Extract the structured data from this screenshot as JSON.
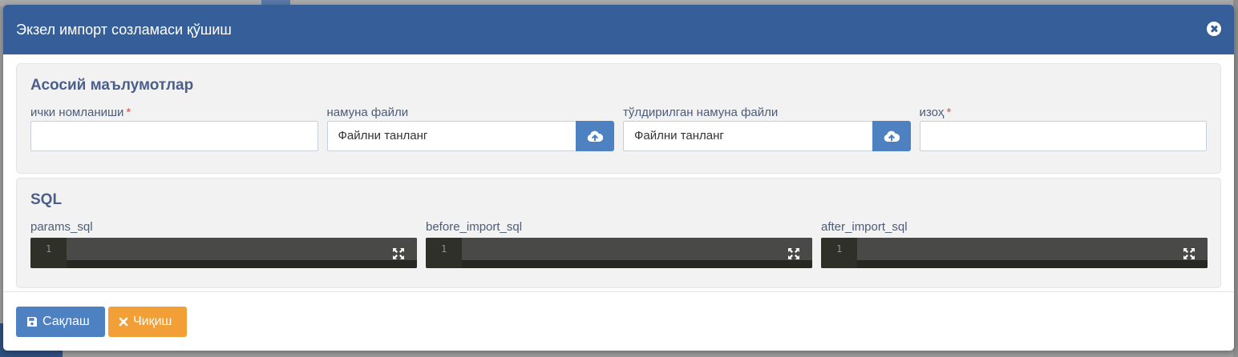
{
  "modal": {
    "title": "Экзел импорт созламаси қўшиш"
  },
  "basic": {
    "title": "Асосий маълумотлар",
    "fields": {
      "internal_name": {
        "label": "ички номланиши",
        "required_mark": "*",
        "value": ""
      },
      "sample_file": {
        "label": "намуна файли",
        "placeholder": "Файлни танланг"
      },
      "filled_sample_file": {
        "label": "тўлдирилган намуна файли",
        "placeholder": "Файлни танланг"
      },
      "note": {
        "label": "изоҳ",
        "required_mark": "*",
        "value": ""
      }
    }
  },
  "sql": {
    "title": "SQL",
    "editors": [
      {
        "label": "params_sql",
        "line_number": "1"
      },
      {
        "label": "before_import_sql",
        "line_number": "1"
      },
      {
        "label": "after_import_sql",
        "line_number": "1"
      }
    ]
  },
  "footer": {
    "save_label": "Сақлаш",
    "exit_label": "Чиқиш"
  },
  "colors": {
    "header": "#365f99",
    "primary": "#4e81c2",
    "warning": "#f29f37",
    "editor_bg": "#272822"
  },
  "icons": {
    "close": "close-icon",
    "upload": "cloud-upload-icon",
    "expand": "expand-icon",
    "save": "floppy-disk-icon",
    "exit": "times-icon"
  }
}
